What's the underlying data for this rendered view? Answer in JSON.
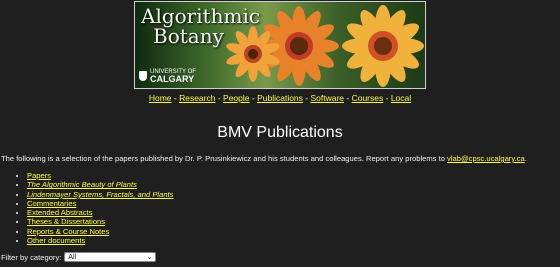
{
  "banner": {
    "title_line1": "Algorithmic",
    "title_line2": "Botany",
    "univ_small": "UNIVERSITY OF",
    "univ_big": "CALGARY"
  },
  "nav": {
    "items": [
      "Home",
      "Research",
      "People",
      "Publications",
      "Software",
      "Courses",
      "Local"
    ],
    "separator": " - "
  },
  "page": {
    "heading": "BMV Publications",
    "intro_text": "The following is a selection of the papers published by Dr. P. Prusinkiewicz and his students and colleagues. Report any problems to ",
    "intro_email": "vlab@cpsc.ucalgary.ca",
    "intro_end": "."
  },
  "categories": [
    {
      "label": "Papers",
      "italic": false
    },
    {
      "label": "The Algorithmic Beauty of Plants",
      "italic": true
    },
    {
      "label": "Lindenmayer Systems, Fractals, and Plants",
      "italic": true
    },
    {
      "label": "Commentaries",
      "italic": false
    },
    {
      "label": "Extended Abstracts",
      "italic": false
    },
    {
      "label": "Theses & Dissertations",
      "italic": false
    },
    {
      "label": "Reports & Course Notes",
      "italic": false
    },
    {
      "label": "Other documents",
      "italic": false
    }
  ],
  "filter": {
    "label": "Filter by category:",
    "selected": "All"
  },
  "colors": {
    "background": "#1f1f1f",
    "link": "#ffff3a",
    "text": "#f2f2f2"
  }
}
